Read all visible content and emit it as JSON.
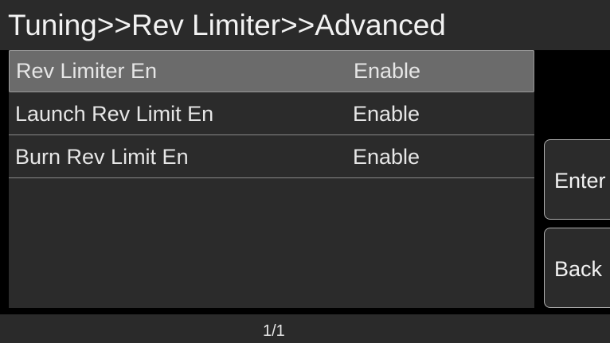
{
  "header": {
    "breadcrumb": "Tuning>>Rev Limiter>>Advanced"
  },
  "list": {
    "rows": [
      {
        "label": "Rev Limiter En",
        "value": "Enable",
        "selected": true
      },
      {
        "label": "Launch Rev Limit En",
        "value": "Enable",
        "selected": false
      },
      {
        "label": "Burn Rev Limit En",
        "value": "Enable",
        "selected": false
      }
    ]
  },
  "softkeys": {
    "enter_label": "Enter",
    "back_label": "Back"
  },
  "footer": {
    "page_indicator": "1/1"
  },
  "colors": {
    "background": "#000000",
    "bar": "#2a2a2a",
    "list_bg": "#2b2b2b",
    "selected_row": "#6b6b6b",
    "text": "#e6e6e6"
  }
}
